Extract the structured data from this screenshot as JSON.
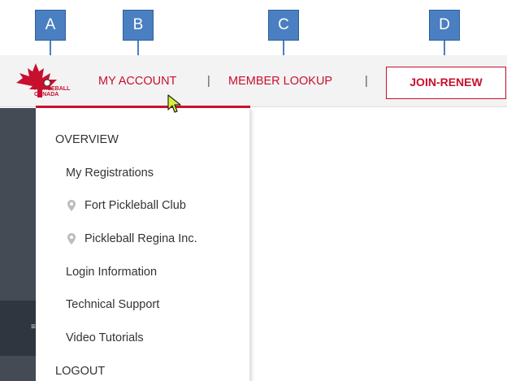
{
  "callouts": {
    "a": "A",
    "b": "B",
    "c": "C",
    "d": "D"
  },
  "logo": {
    "text_line1": "PICKLEBALL",
    "text_line2": "CANADA",
    "icon": "maple-leaf-icon"
  },
  "nav": {
    "my_account": "MY ACCOUNT",
    "separator": "|",
    "member_lookup": "MEMBER LOOKUP",
    "join_renew": "JOIN-RENEW"
  },
  "menu": {
    "overview": "OVERVIEW",
    "my_registrations": "My Registrations",
    "clubs": [
      {
        "label": "Fort Pickleball Club",
        "icon": "map-pin-icon"
      },
      {
        "label": "Pickleball Regina Inc.",
        "icon": "map-pin-icon"
      }
    ],
    "login_information": "Login Information",
    "technical_support": "Technical Support",
    "video_tutorials": "Video Tutorials",
    "logout": "LOGOUT"
  },
  "colors": {
    "brand_red": "#c8102e",
    "callout_blue": "#4a7fc1",
    "nav_bg": "#f3f3f3",
    "sidebar_dark": "#444b55"
  }
}
